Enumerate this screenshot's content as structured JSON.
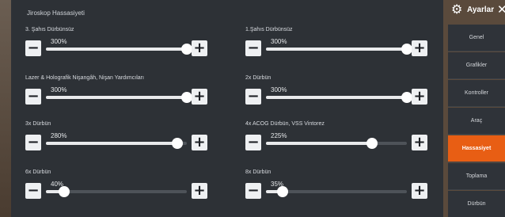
{
  "panel": {
    "title": "Jiroskop Hassasiyeti"
  },
  "sidebar": {
    "title": "Ayarlar",
    "tabs": [
      {
        "label": "Genel",
        "active": false
      },
      {
        "label": "Grafikler",
        "active": false
      },
      {
        "label": "Kontroller",
        "active": false
      },
      {
        "label": "Araç",
        "active": false
      },
      {
        "label": "Hassasiyet",
        "active": true
      },
      {
        "label": "Toplama",
        "active": false
      },
      {
        "label": "Dürbün",
        "active": false
      }
    ]
  },
  "settings": [
    {
      "label": "3. Şahıs Dürbünsüz",
      "value_text": "300%",
      "level": 1.0
    },
    {
      "label": "1.Şahıs Dürbünsüz",
      "value_text": "300%",
      "level": 1.0
    },
    {
      "label": "Lazer & Holografik Nişangâh, Nişan Yardımcıları",
      "value_text": "300%",
      "level": 1.0
    },
    {
      "label": "2x Dürbün",
      "value_text": "300%",
      "level": 1.0
    },
    {
      "label": "3x Dürbün",
      "value_text": "280%",
      "level": 0.93
    },
    {
      "label": "4x ACOG Dürbün, VSS Vintorez",
      "value_text": "225%",
      "level": 0.75
    },
    {
      "label": "6x Dürbün",
      "value_text": "40%",
      "level": 0.13
    },
    {
      "label": "8x Dürbün",
      "value_text": "35%",
      "level": 0.12
    }
  ],
  "icons": {
    "gear": "gear-icon",
    "close": "close-icon",
    "minus": "minus-icon",
    "plus": "plus-icon"
  },
  "colors": {
    "accent": "#e85e14",
    "panel": "#2c3036",
    "button": "#eef0f2"
  }
}
